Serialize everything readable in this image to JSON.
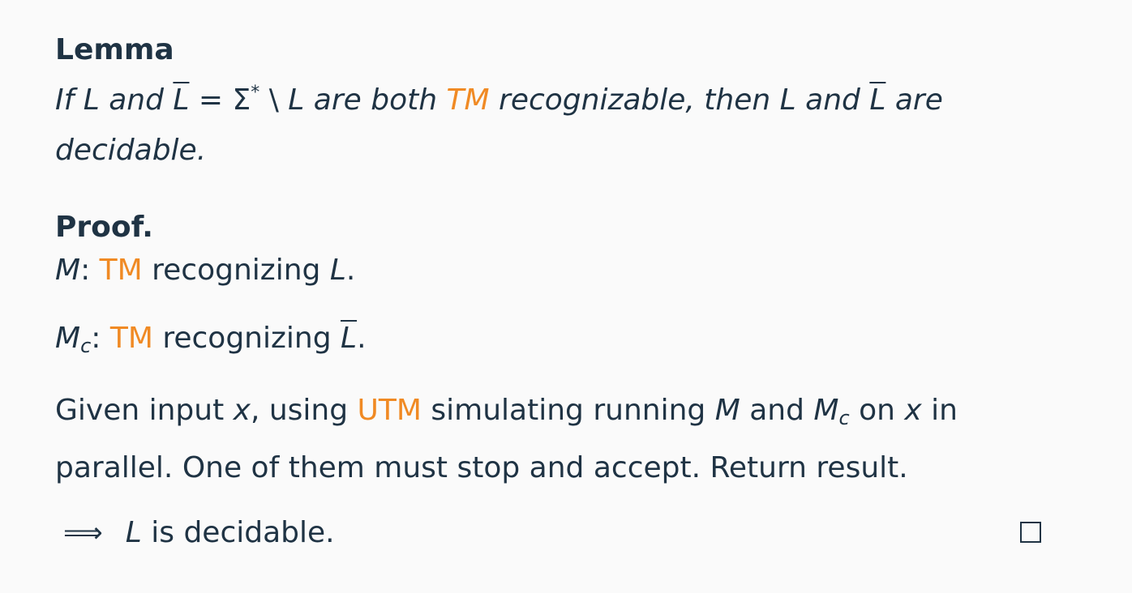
{
  "lemma": {
    "title": "Lemma",
    "t1": "If ",
    "L": "L",
    "and1": " and ",
    "Lbar": "L",
    "eq": " = Σ",
    "star": "*",
    "setminus": " \\ ",
    "L2": "L",
    "are_both": " are both ",
    "tm": "TM",
    "recog": " recognizable, then ",
    "L3": "L",
    "and2": " and ",
    "Lbar2": "L",
    "are": " are decidable."
  },
  "proof": {
    "title": "Proof.",
    "line1": {
      "M": "M",
      "colon": ": ",
      "tm": "TM",
      "text": " recognizing ",
      "L": "L",
      "dot": "."
    },
    "line2": {
      "M": "M",
      "sub": "c",
      "colon": ": ",
      "tm": "TM",
      "text": " recognizing ",
      "Lbar": "L",
      "dot": "."
    },
    "line3": {
      "t1": "Given input ",
      "x": "x",
      "t2": ", using ",
      "utm": "UTM",
      "t3": " simulating running ",
      "M": "M",
      "t4": " and ",
      "Mc": "M",
      "sub": "c",
      "t5": " on ",
      "x2": "x",
      "t6": " in parallel. One of them must stop and accept. Return result."
    },
    "conclusion": {
      "arrow": "⟹",
      "L": "L",
      "text": " is decidable."
    }
  },
  "colors": {
    "text": "#1f3344",
    "accent": "#f08a24",
    "background": "#fafafa"
  }
}
